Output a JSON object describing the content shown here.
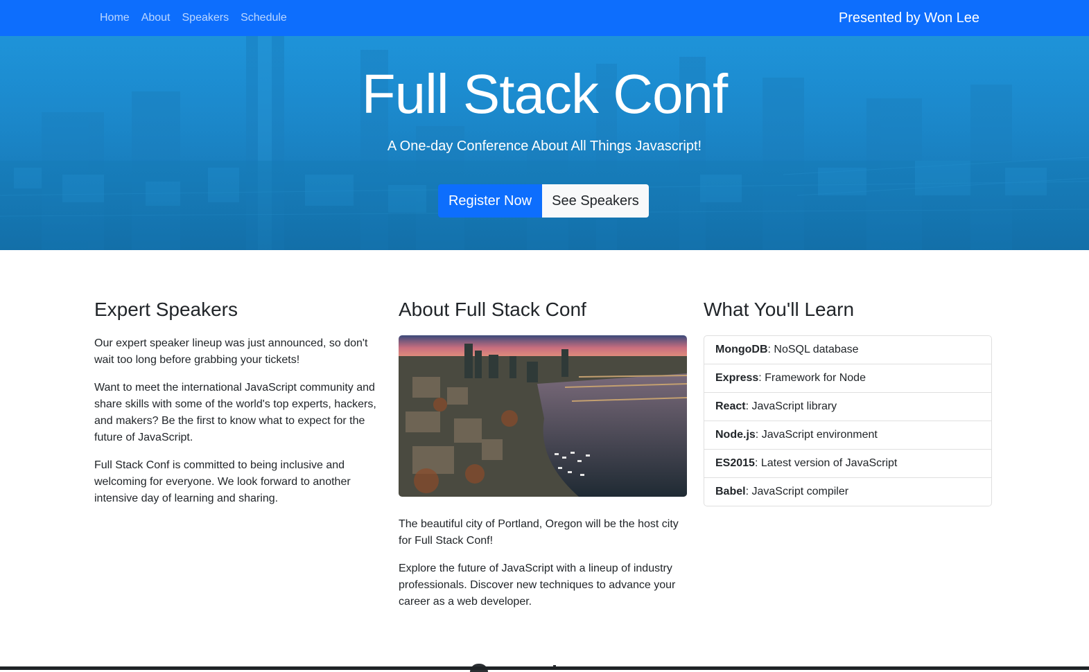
{
  "nav": {
    "links": [
      "Home",
      "About",
      "Speakers",
      "Schedule"
    ],
    "presenter": "Presented by Won Lee"
  },
  "hero": {
    "title": "Full Stack Conf",
    "subtitle": "A One-day Conference About All Things Javascript!",
    "register_label": "Register Now",
    "speakers_label": "See Speakers"
  },
  "speakers": {
    "heading": "Expert Speakers",
    "paragraphs": [
      "Our expert speaker lineup was just announced, so don't wait too long before grabbing your tickets!",
      "Want to meet the international JavaScript community and share skills with some of the world's top experts, hackers, and makers? Be the first to know what to expect for the future of JavaScript.",
      "Full Stack Conf is committed to being inclusive and welcoming for everyone. We look forward to another intensive day of learning and sharing."
    ]
  },
  "about": {
    "heading": "About Full Stack Conf",
    "image_subject": "portland-aerial-photo",
    "paragraphs": [
      "The beautiful city of Portland, Oregon will be the host city for Full Stack Conf!",
      "Explore the future of JavaScript with a lineup of industry professionals. Discover new techniques to advance your career as a web developer."
    ]
  },
  "learn": {
    "heading": "What You'll Learn",
    "items": [
      {
        "term": "MongoDB",
        "desc": ": NoSQL database"
      },
      {
        "term": "Express",
        "desc": ": Framework for Node"
      },
      {
        "term": "React",
        "desc": ": JavaScript library"
      },
      {
        "term": "Node.js",
        "desc": ": JavaScript environment"
      },
      {
        "term": "ES2015",
        "desc": ": Latest version of JavaScript"
      },
      {
        "term": "Babel",
        "desc": ": JavaScript compiler"
      }
    ]
  },
  "colors": {
    "primary": "#0d6efd",
    "hero_blue": "#1a86c9",
    "text": "#212529"
  }
}
